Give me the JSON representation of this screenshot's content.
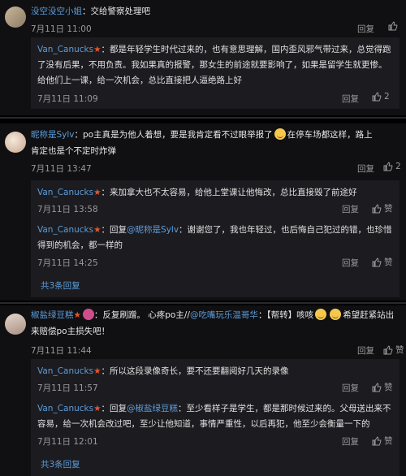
{
  "c1": {
    "user": "没空没空小姐",
    "text": "：交给警察处理吧",
    "time": "7月11日 11:00",
    "reply_label": "回复",
    "replies": [
      {
        "user": "Van_Canucks",
        "text": "：都是年轻学生时代过来的，也有意思理解，国内歪风邪气带过来，总觉得跑了没有后果，不用负责。我如果真的报警，那女生的前途就要影响了，如果是留学生就更惨。给他们上一课，给一次机会，总比直接把人逼绝路上好",
        "time": "7月11日 11:09",
        "reply_label": "回复",
        "likes": "2"
      }
    ]
  },
  "c2": {
    "user": "昵称是Sylv",
    "text_a": "：po主真是为他人着想，要是我肯定看不过眼举报了",
    "text_b": "在停车场都这样，路上肯定也是个不定时炸弹",
    "time": "7月11日 13:47",
    "reply_label": "回复",
    "likes": "2",
    "replies": [
      {
        "user": "Van_Canucks",
        "text": "：来加拿大也不太容易，给他上堂课让他悔改，总比直接毁了前途好",
        "time": "7月11日 13:58",
        "reply_label": "回复",
        "like_label": "赞"
      },
      {
        "user": "Van_Canucks",
        "prefix": "：回复",
        "mention": "@昵称是Sylv",
        "text": "：谢谢您了，我也年轻过，也后悔自己犯过的错，也珍惜得到的机会，都一样的",
        "time": "7月11日 14:25",
        "reply_label": "回复",
        "like_label": "赞"
      }
    ],
    "more": "共3条回复"
  },
  "c3": {
    "user": "椒盐绿豆糕",
    "text_a": "：反复刷蹭。",
    "text_b": "心疼po主//",
    "mention": "@吃嘴玩乐温哥华",
    "text_c": "：【帮转】咳咳",
    "text_d": "希望赶紧站出来赔偿po主损失吧！",
    "time": "7月11日 11:44",
    "reply_label": "回复",
    "like_label": "赞",
    "replies": [
      {
        "user": "Van_Canucks",
        "text": "：所以这段录像奇长，要不还要翻阅好几天的录像",
        "time": "7月11日 11:57",
        "reply_label": "回复",
        "like_label": "赞"
      },
      {
        "user": "Van_Canucks",
        "prefix": "：回复",
        "mention": "@椒盐绿豆糕",
        "text": "：至少看样子是学生，都是那时候过来的。父母送出来不容易，给一次机会改过吧，至少让他知道，事情严重性，以后再犯，他至少会衡量一下的",
        "time": "7月11日 12:01",
        "reply_label": "回复",
        "like_label": "赞"
      }
    ],
    "more": "共3条回复"
  }
}
